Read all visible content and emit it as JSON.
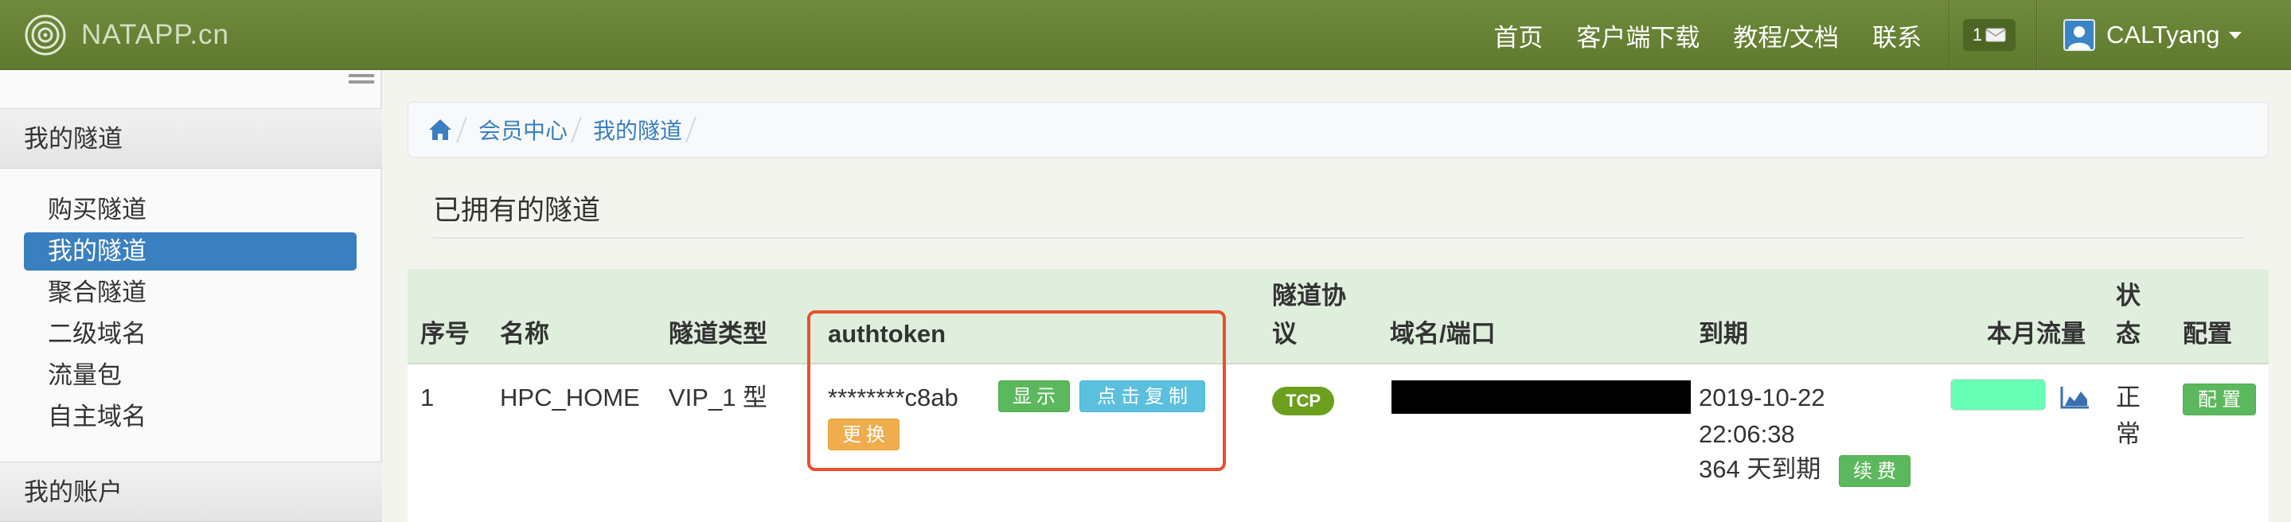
{
  "navbar": {
    "brand": "NATAPP.cn",
    "links": [
      "首页",
      "客户端下载",
      "教程/文档",
      "联系"
    ],
    "message_count": "1",
    "username": "CALTyang"
  },
  "sidebar": {
    "section_tunnels": "我的隧道",
    "items": [
      "购买隧道",
      "我的隧道",
      "聚合隧道",
      "二级域名",
      "流量包",
      "自主域名"
    ],
    "section_account": "我的账户"
  },
  "breadcrumb": [
    "会员中心",
    "我的隧道"
  ],
  "page_title": "已拥有的隧道",
  "table": {
    "headers": {
      "index": "序号",
      "name": "名称",
      "type": "隧道类型",
      "authtoken": "authtoken",
      "protocol_line1": "隧道协",
      "protocol_line2": "议",
      "domain": "域名/端口",
      "expire": "到期",
      "traffic": "本月流量",
      "status_line1": "状",
      "status_line2": "态",
      "config": "配置"
    },
    "row": {
      "index": "1",
      "name": "HPC_HOME",
      "type": "VIP_1 型",
      "authtoken_masked": "********c8ab",
      "show_button": "显示",
      "copy_button": "点击复制",
      "replace_button": "更换",
      "protocol": "TCP",
      "expire_date": "2019-10-22",
      "expire_time": "22:06:38",
      "expire_remaining": "364 天到期",
      "renew_button": "续费",
      "status_line1": "正",
      "status_line2": "常",
      "config_button": "配置"
    }
  },
  "colors": {
    "navbar": "#66823a",
    "active_item": "#3a7fbf",
    "table_header": "#dfeedd",
    "highlight": "#e8502e",
    "traffic_fill": "#66ffb3"
  }
}
